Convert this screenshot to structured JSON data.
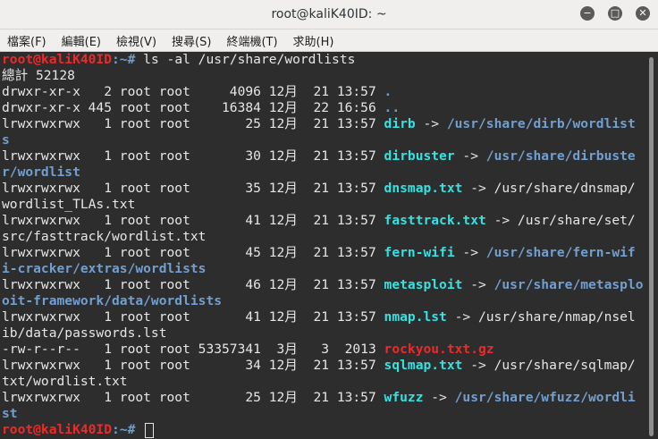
{
  "window": {
    "title": "root@kaliK40ID: ~",
    "min_glyph": "−",
    "max_glyph": "□",
    "close_glyph": "✕"
  },
  "menu": [
    "檔案(F)",
    "編輯(E)",
    "檢視(V)",
    "搜尋(S)",
    "終端機(T)",
    "求助(H)"
  ],
  "prompt": {
    "user_host": "root@kaliK40ID",
    "path": ":~# ",
    "path_idle": ":~# "
  },
  "command": "ls -al /usr/share/wordlists",
  "total": "總計 52128",
  "lines": {
    "l02_info": "drwxr-xr-x   2 root root     4096 12月  21 13:57 ",
    "l02_name": ".",
    "l03_info": "drwxr-xr-x 445 root root    16384 12月  22 16:56 ",
    "l03_name": "..",
    "l04_info": "lrwxrwxrwx   1 root root       25 12月  21 13:57 ",
    "l04_name": "dirb",
    "l04_arrow": " -> ",
    "l04_target": "/usr/share/dirb/wordlist",
    "l05_target": "s",
    "l06_info": "lrwxrwxrwx   1 root root       30 12月  21 13:57 ",
    "l06_name": "dirbuster",
    "l06_arrow": " -> ",
    "l06_target": "/usr/share/dirbuste",
    "l07_target": "r/wordlist",
    "l08_info": "lrwxrwxrwx   1 root root       35 12月  21 13:57 ",
    "l08_name": "dnsmap.txt",
    "l08_rest": " -> /usr/share/dnsmap/",
    "l09_rest": "wordlist_TLAs.txt",
    "l10_info": "lrwxrwxrwx   1 root root       41 12月  21 13:57 ",
    "l10_name": "fasttrack.txt",
    "l10_rest": " -> /usr/share/set/",
    "l11_rest": "src/fasttrack/wordlist.txt",
    "l12_info": "lrwxrwxrwx   1 root root       45 12月  21 13:57 ",
    "l12_name": "fern-wifi",
    "l12_arrow": " -> ",
    "l12_target": "/usr/share/fern-wif",
    "l13_target": "i-cracker/extras/wordlists",
    "l14_info": "lrwxrwxrwx   1 root root       46 12月  21 13:57 ",
    "l14_name": "metasploit",
    "l14_arrow": " -> ",
    "l14_target": "/usr/share/metasplo",
    "l15_target": "oit-framework/data/wordlists",
    "l16_info": "lrwxrwxrwx   1 root root       41 12月  21 13:57 ",
    "l16_name": "nmap.lst",
    "l16_rest": " -> /usr/share/nmap/nsel",
    "l17_rest": "ib/data/passwords.lst",
    "l18_info": "-rw-r--r--   1 root root 53357341  3月   3  2013 ",
    "l18_name": "rockyou.txt.gz",
    "l19_info": "lrwxrwxrwx   1 root root       34 12月  21 13:57 ",
    "l19_name": "sqlmap.txt",
    "l19_rest": " -> /usr/share/sqlmap/",
    "l20_rest": "txt/wordlist.txt",
    "l21_info": "lrwxrwxrwx   1 root root       25 12月  21 13:57 ",
    "l21_name": "wfuzz",
    "l21_arrow": " -> ",
    "l21_target": "/usr/share/wfuzz/wordli",
    "l22_target": "st"
  }
}
